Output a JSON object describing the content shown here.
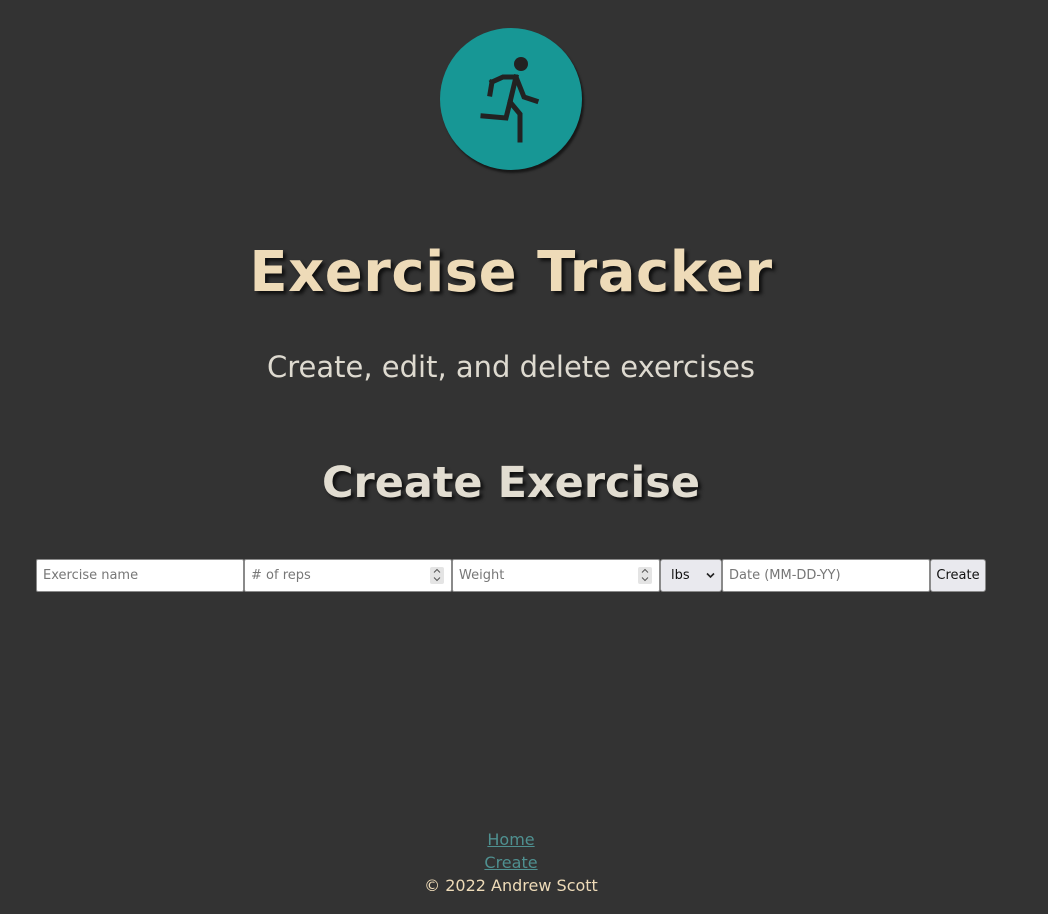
{
  "header": {
    "logo_icon": "running-person-icon",
    "logo_color": "#179795",
    "title": "Exercise Tracker",
    "subtitle": "Create, edit, and delete exercises"
  },
  "main": {
    "heading": "Create Exercise",
    "form": {
      "name_placeholder": "Exercise name",
      "reps_placeholder": "# of reps",
      "weight_placeholder": "Weight",
      "unit_value": "lbs",
      "date_placeholder": "Date (MM-DD-YY)",
      "create_label": "Create"
    }
  },
  "footer": {
    "nav": [
      {
        "label": "Home"
      },
      {
        "label": "Create"
      }
    ],
    "copyright": "© 2022 Andrew Scott"
  },
  "colors": {
    "background": "#333333",
    "title": "#eedbb8",
    "link": "#4f9090"
  }
}
